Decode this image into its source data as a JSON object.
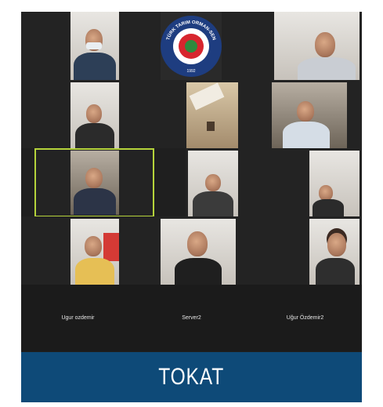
{
  "meeting": {
    "participants": [
      {
        "name": "Ugur ozdemir"
      },
      {
        "name": "Server2"
      },
      {
        "name": "Uğur Özdemir2"
      }
    ],
    "logo_text": "TÜRK TARIM ORMAN-SEN",
    "logo_year": "1992"
  },
  "banner": {
    "label": "TOKAT"
  },
  "colors": {
    "frame_bg": "#1f1f1f",
    "speaker_highlight": "#b5d33b",
    "banner_bg": "#0e4a78",
    "logo_blue": "#1e3d80",
    "logo_red": "#d7262e"
  }
}
